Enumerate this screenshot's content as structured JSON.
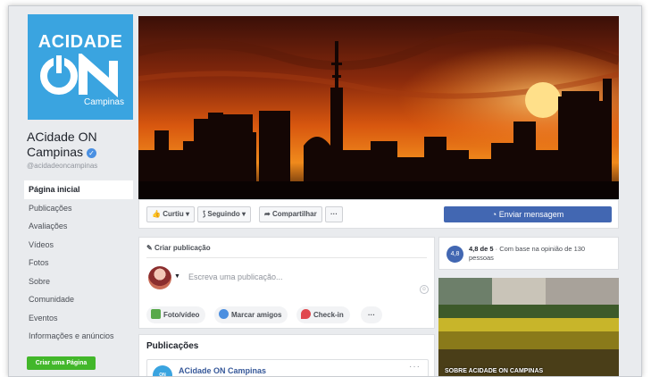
{
  "logo": {
    "line1": "ACIDADE",
    "line2": "Campinas"
  },
  "page": {
    "name": "ACidade ON Campinas",
    "handle": "@acidadeoncampinas"
  },
  "nav": [
    "Página inicial",
    "Publicações",
    "Avaliações",
    "Vídeos",
    "Fotos",
    "Sobre",
    "Comunidade",
    "Eventos",
    "Informações e anúncios"
  ],
  "create_page_label": "Criar uma Página",
  "actions": {
    "like": "Curtiu ▾",
    "following": "Seguindo ▾",
    "share": "Compartilhar",
    "more": "···",
    "send_message": "Enviar mensagem"
  },
  "composer": {
    "heading": "Criar publicação",
    "placeholder": "Escreva uma publicação...",
    "photo_video": "Foto/vídeo",
    "tag_friends": "Marcar amigos",
    "checkin": "Check-in",
    "more": "···"
  },
  "rating": {
    "badge": "4,8",
    "score": "4,8 de 5",
    "text": " · Com base na opinião de 130 pessoas"
  },
  "about_caption": "SOBRE ACIDADE ON CAMPINAS",
  "posts": {
    "title": "Publicações",
    "author": "ACidade ON Campinas",
    "more": "···"
  },
  "colors": {
    "brand_blue": "#3aa4e0",
    "facebook_blue": "#4267b2",
    "green": "#42b72a",
    "background": "#e9ebee"
  }
}
